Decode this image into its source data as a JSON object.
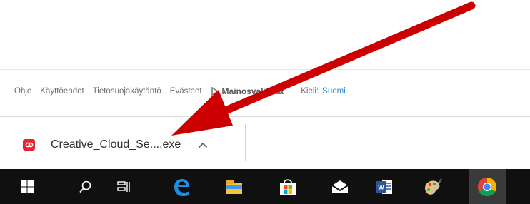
{
  "footer": {
    "help": "Ohje",
    "terms": "Käyttöehdot",
    "privacy": "Tietosuojakäytäntö",
    "cookies": "Evästeet",
    "ad_choices": "Mainosvalinnat",
    "language_label": "Kieli:",
    "language_value": "Suomi"
  },
  "download_bar": {
    "filename": "Creative_Cloud_Se....exe",
    "icon": "creative-cloud-icon",
    "expand_icon": "chevron-up-icon"
  },
  "taskbar": {
    "items": [
      {
        "icon": "windows-start-icon"
      },
      {
        "icon": "search-icon"
      },
      {
        "icon": "task-view-icon"
      },
      {
        "icon": "edge-icon"
      },
      {
        "icon": "file-explorer-icon"
      },
      {
        "icon": "store-icon"
      },
      {
        "icon": "mail-icon"
      },
      {
        "icon": "word-icon"
      },
      {
        "icon": "paint-icon"
      },
      {
        "icon": "chrome-icon",
        "active": true
      }
    ]
  },
  "annotation": {
    "color": "#cc0000"
  },
  "colors": {
    "taskbar_bg": "#101010",
    "link_blue": "#2f8fd9",
    "cc_red": "#e8242e"
  }
}
